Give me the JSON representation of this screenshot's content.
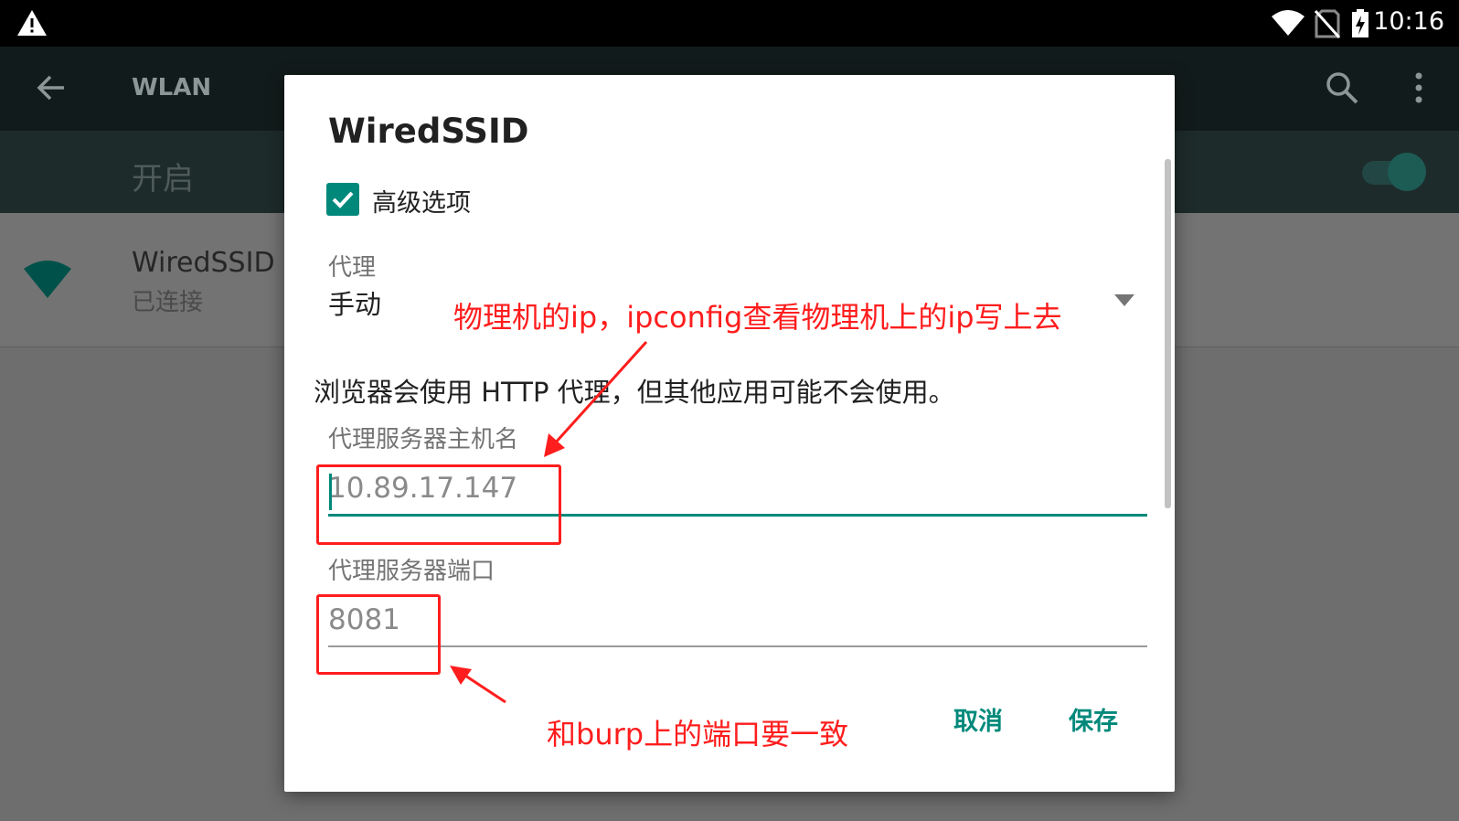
{
  "status_bar": {
    "time": "10:16",
    "icons": [
      "warning-icon",
      "wifi-signal-icon",
      "no-sim-icon",
      "battery-charging-icon"
    ]
  },
  "app_bar": {
    "title": "WLAN",
    "icons": [
      "back-arrow-icon",
      "search-icon",
      "more-vert-icon"
    ]
  },
  "wifi_switch": {
    "label": "开启",
    "on": true
  },
  "network": {
    "name": "WiredSSID",
    "status": "已连接"
  },
  "dialog": {
    "title": "WiredSSID",
    "advanced_options": {
      "label": "高级选项",
      "checked": true
    },
    "proxy": {
      "label": "代理",
      "value": "手动"
    },
    "proxy_note": "浏览器会使用 HTTP 代理，但其他应用可能不会使用。",
    "proxy_host": {
      "label": "代理服务器主机名",
      "value": "10.89.17.147"
    },
    "proxy_port": {
      "label": "代理服务器端口",
      "value": "8081"
    },
    "buttons": {
      "cancel": "取消",
      "save": "保存"
    }
  },
  "annotations": {
    "ip_note": "物理机的ip，ipconfig查看物理机上的ip写上去",
    "port_note": "和burp上的端口要一致"
  },
  "colors": {
    "accent": "#00897b",
    "annotation": "#ff1d1d"
  }
}
